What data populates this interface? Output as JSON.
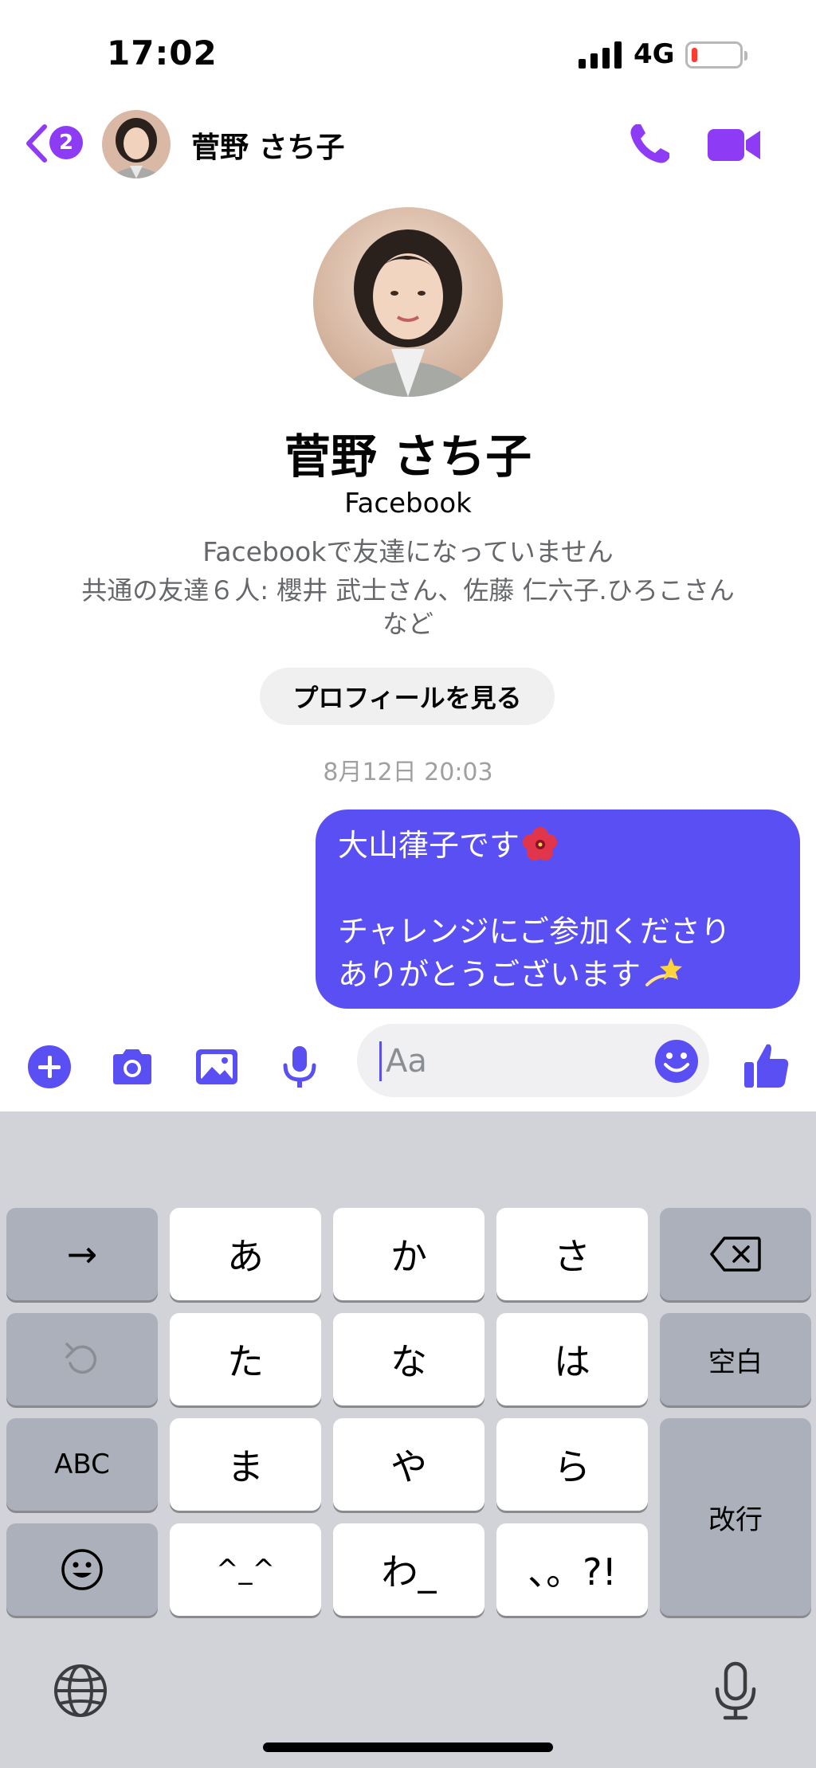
{
  "status_bar": {
    "time": "17:02",
    "network": "4G",
    "battery_color": "#ff3b30"
  },
  "header": {
    "unread_count": "2",
    "contact_name": "菅野 さち子",
    "accent_color": "#8e3bf5"
  },
  "profile": {
    "name": "菅野 さち子",
    "platform": "Facebook",
    "status": "Facebookで友達になっていません",
    "mutual_line1": "共通の友達６人: 櫻井 武士さん、佐藤 仁六子.ひろこさん",
    "mutual_line2": "など",
    "view_profile_label": "プロフィールを見る"
  },
  "timestamp": "8月12日 20:03",
  "message": {
    "line1": "大山葎子です",
    "line2": "チャレンジにご参加くださり",
    "line3": "ありがとうございます",
    "bubble_color": "#5a4ff2"
  },
  "composer": {
    "placeholder": "Aa"
  },
  "keyboard": {
    "arrow": "→",
    "a": "あ",
    "ka": "か",
    "sa": "さ",
    "ta": "た",
    "na": "な",
    "ha": "は",
    "space": "空白",
    "abc": "ABC",
    "ma": "ま",
    "ya": "や",
    "ra": "ら",
    "enter": "改行",
    "kaomoji": "^_^",
    "wa": "わ_",
    "punct": "、。?!"
  }
}
